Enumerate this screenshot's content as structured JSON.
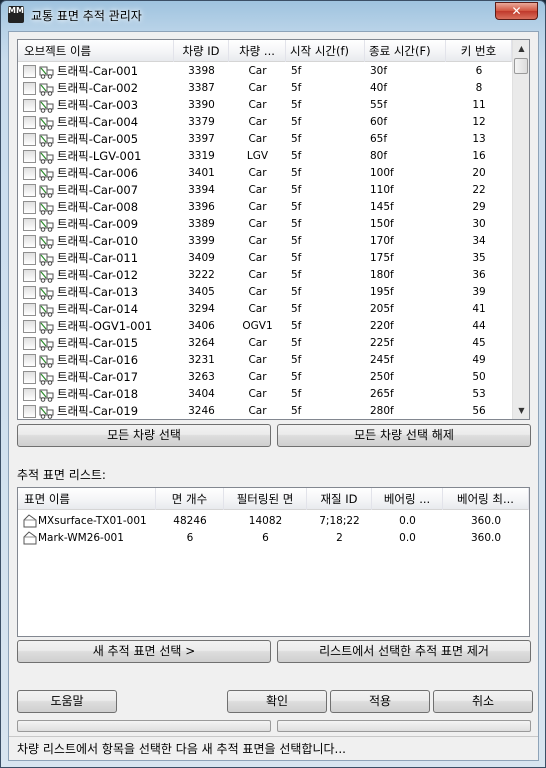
{
  "window": {
    "title": "교통 표면 추적 관리자",
    "icon_text": "MM",
    "close_symbol": "✕"
  },
  "vehicle_list": {
    "columns": [
      "오브젝트 이름",
      "차량 ID",
      "차량 ...",
      "시작 시간(f)",
      "종료 시간(F)",
      "키 번호"
    ],
    "rows": [
      {
        "name": "트래픽-Car-001",
        "id": "3398",
        "type": "Car",
        "start": "5f",
        "end": "30f",
        "key": "6"
      },
      {
        "name": "트래픽-Car-002",
        "id": "3387",
        "type": "Car",
        "start": "5f",
        "end": "40f",
        "key": "8"
      },
      {
        "name": "트래픽-Car-003",
        "id": "3390",
        "type": "Car",
        "start": "5f",
        "end": "55f",
        "key": "11"
      },
      {
        "name": "트래픽-Car-004",
        "id": "3379",
        "type": "Car",
        "start": "5f",
        "end": "60f",
        "key": "12"
      },
      {
        "name": "트래픽-Car-005",
        "id": "3397",
        "type": "Car",
        "start": "5f",
        "end": "65f",
        "key": "13"
      },
      {
        "name": "트래픽-LGV-001",
        "id": "3319",
        "type": "LGV",
        "start": "5f",
        "end": "80f",
        "key": "16"
      },
      {
        "name": "트래픽-Car-006",
        "id": "3401",
        "type": "Car",
        "start": "5f",
        "end": "100f",
        "key": "20"
      },
      {
        "name": "트래픽-Car-007",
        "id": "3394",
        "type": "Car",
        "start": "5f",
        "end": "110f",
        "key": "22"
      },
      {
        "name": "트래픽-Car-008",
        "id": "3396",
        "type": "Car",
        "start": "5f",
        "end": "145f",
        "key": "29"
      },
      {
        "name": "트래픽-Car-009",
        "id": "3389",
        "type": "Car",
        "start": "5f",
        "end": "150f",
        "key": "30"
      },
      {
        "name": "트래픽-Car-010",
        "id": "3399",
        "type": "Car",
        "start": "5f",
        "end": "170f",
        "key": "34"
      },
      {
        "name": "트래픽-Car-011",
        "id": "3409",
        "type": "Car",
        "start": "5f",
        "end": "175f",
        "key": "35"
      },
      {
        "name": "트래픽-Car-012",
        "id": "3222",
        "type": "Car",
        "start": "5f",
        "end": "180f",
        "key": "36"
      },
      {
        "name": "트래픽-Car-013",
        "id": "3405",
        "type": "Car",
        "start": "5f",
        "end": "195f",
        "key": "39"
      },
      {
        "name": "트래픽-Car-014",
        "id": "3294",
        "type": "Car",
        "start": "5f",
        "end": "205f",
        "key": "41"
      },
      {
        "name": "트래픽-OGV1-001",
        "id": "3406",
        "type": "OGV1",
        "start": "5f",
        "end": "220f",
        "key": "44"
      },
      {
        "name": "트래픽-Car-015",
        "id": "3264",
        "type": "Car",
        "start": "5f",
        "end": "225f",
        "key": "45"
      },
      {
        "name": "트래픽-Car-016",
        "id": "3231",
        "type": "Car",
        "start": "5f",
        "end": "245f",
        "key": "49"
      },
      {
        "name": "트래픽-Car-017",
        "id": "3263",
        "type": "Car",
        "start": "5f",
        "end": "250f",
        "key": "50"
      },
      {
        "name": "트래픽-Car-018",
        "id": "3404",
        "type": "Car",
        "start": "5f",
        "end": "265f",
        "key": "53"
      },
      {
        "name": "트래픽-Car-019",
        "id": "3246",
        "type": "Car",
        "start": "5f",
        "end": "280f",
        "key": "56"
      }
    ]
  },
  "buttons": {
    "select_all": "모든 차량 선택",
    "deselect_all": "모든 차량 선택 해제",
    "new_surface": "새 추적 표면 선택 >",
    "remove_surface": "리스트에서 선택한 추적 표면 제거",
    "help": "도움말",
    "ok": "확인",
    "apply": "적용",
    "cancel": "취소"
  },
  "surface_section": {
    "label": "추적 표면 리스트:",
    "columns": [
      "표면 이름",
      "면 개수",
      "필터링된 면",
      "재질 ID",
      "베어링 ...",
      "베어링 최..."
    ],
    "rows": [
      {
        "name": "MXsurface-TX01-001",
        "faces": "48246",
        "filtered": "14082",
        "mat": "7;18;22",
        "bmin": "0.0",
        "bmax": "360.0"
      },
      {
        "name": "Mark-WM26-001",
        "faces": "6",
        "filtered": "6",
        "mat": "2",
        "bmin": "0.0",
        "bmax": "360.0"
      }
    ]
  },
  "status": {
    "text": "차량 리스트에서 항목을 선택한 다음 새 추적 표면을 선택합니다..."
  },
  "icons": {
    "car": "car-icon",
    "surface": "surface-icon",
    "checkbox": "checkbox",
    "scroll_up": "scroll-up-arrow-icon",
    "scroll_down": "scroll-down-arrow-icon"
  }
}
